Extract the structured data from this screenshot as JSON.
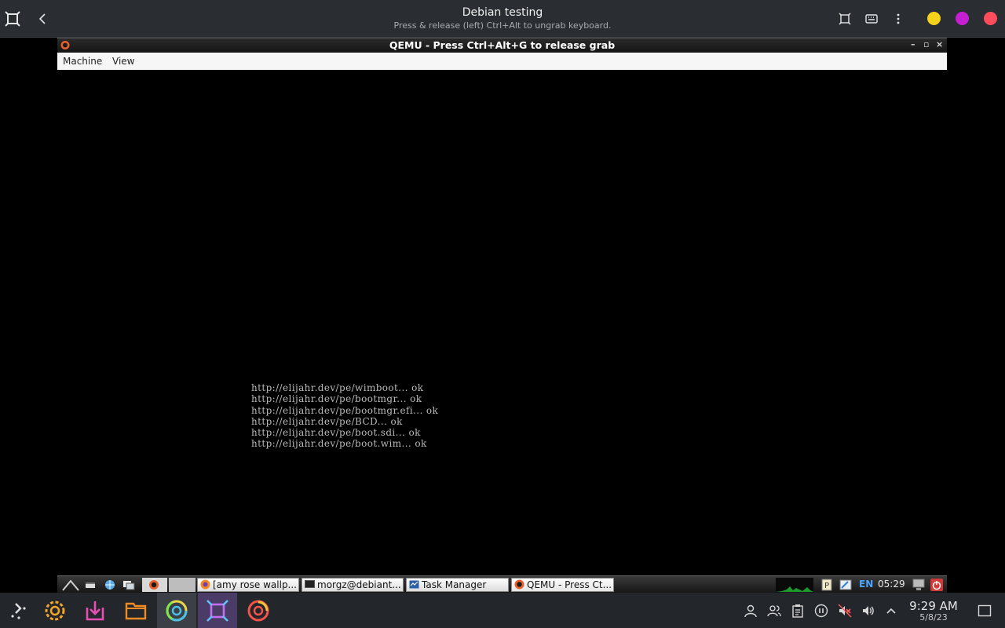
{
  "host_window": {
    "title": "Debian testing",
    "subtitle": "Press & release (left) Ctrl+Alt to ungrab keyboard.",
    "dot_colors": [
      "#f7d21a",
      "#c41fd1",
      "#ff4d5e"
    ]
  },
  "qemu": {
    "title": "QEMU - Press Ctrl+Alt+G to release grab",
    "window_controls": [
      "–",
      "▫",
      "×"
    ],
    "menu": [
      "Machine",
      "View"
    ],
    "boot_log": [
      "http://elijahr.dev/pe/wimboot... ok",
      "http://elijahr.dev/pe/bootmgr... ok",
      "http://elijahr.dev/pe/bootmgr.efi... ok",
      "http://elijahr.dev/pe/BCD... ok",
      "http://elijahr.dev/pe/boot.sdi... ok",
      "http://elijahr.dev/pe/boot.wim... ok"
    ]
  },
  "guest_panel": {
    "launchers": [
      "menu-icon",
      "terminal-icon",
      "network-icon",
      "windows-icon",
      "qemu-icon"
    ],
    "tasks": [
      {
        "label": "[amy rose wallp...",
        "icon": "firefox-icon"
      },
      {
        "label": "morgz@debiant...",
        "icon": "terminal-icon"
      },
      {
        "label": "Task Manager",
        "icon": "task-manager-icon"
      },
      {
        "label": "QEMU - Press Ct...",
        "icon": "qemu-icon"
      }
    ],
    "language": "EN",
    "clock": "05:29"
  },
  "taskbar": {
    "apps": [
      "application-launcher-icon",
      "settings-icon",
      "discover-icon",
      "files-icon",
      "chrome-icon",
      "virtual-machine-icon",
      "firefox-icon"
    ],
    "tray": [
      "user-icon",
      "users-icon",
      "clipboard-icon",
      "pause-icon",
      "mute-icon",
      "volume-icon",
      "chevron-up-icon"
    ],
    "time": "9:29 AM",
    "date": "5/8/23"
  }
}
